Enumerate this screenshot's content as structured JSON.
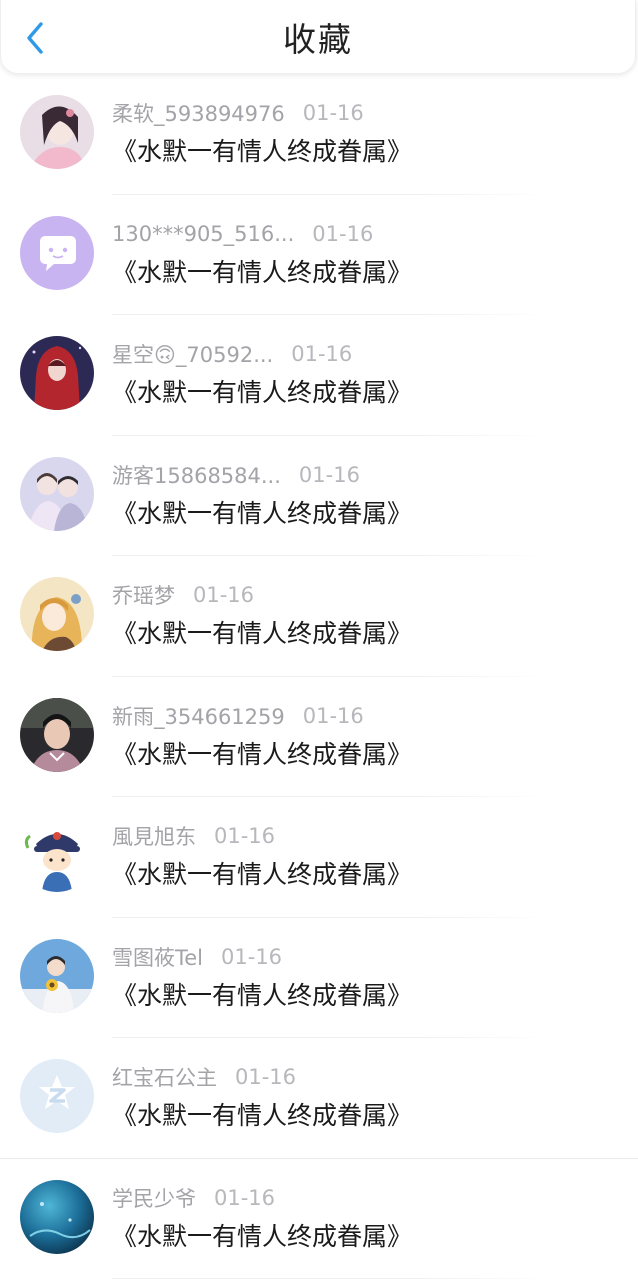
{
  "header": {
    "title": "收藏"
  },
  "colors": {
    "accent": "#2f9be8",
    "text_primary": "#1b1b1b",
    "text_secondary": "#a3a3a8"
  },
  "favorites": [
    {
      "user": "柔软_593894976",
      "date": "01-16",
      "title": "《水默一有情人终成眷属》",
      "avatar": "girl-pink-avatar"
    },
    {
      "user": "130***905_516...",
      "date": "01-16",
      "title": "《水默一有情人终成眷属》",
      "avatar": "chat-bubble-avatar"
    },
    {
      "user": "星空🙃_70592...",
      "date": "01-16",
      "title": "《水默一有情人终成眷属》",
      "avatar": "red-hood-avatar"
    },
    {
      "user": "游客15868584...",
      "date": "01-16",
      "title": "《水默一有情人终成眷属》",
      "avatar": "couple-avatar"
    },
    {
      "user": "乔瑶梦",
      "date": "01-16",
      "title": "《水默一有情人终成眷属》",
      "avatar": "anime-girl-avatar"
    },
    {
      "user": "新雨_354661259",
      "date": "01-16",
      "title": "《水默一有情人终成眷属》",
      "avatar": "boy-photo-avatar"
    },
    {
      "user": "風見旭东",
      "date": "01-16",
      "title": "《水默一有情人终成眷属》",
      "avatar": "cartoon-official-avatar"
    },
    {
      "user": "雪图莜Tel",
      "date": "01-16",
      "title": "《水默一有情人终成眷属》",
      "avatar": "sunflower-avatar"
    },
    {
      "user": "红宝石公主",
      "date": "01-16",
      "title": "《水默一有情人终成眷属》",
      "avatar": "default-z-avatar"
    },
    {
      "user": "学民少爷",
      "date": "01-16",
      "title": "《水默一有情人终成眷属》",
      "avatar": "ocean-avatar"
    }
  ]
}
